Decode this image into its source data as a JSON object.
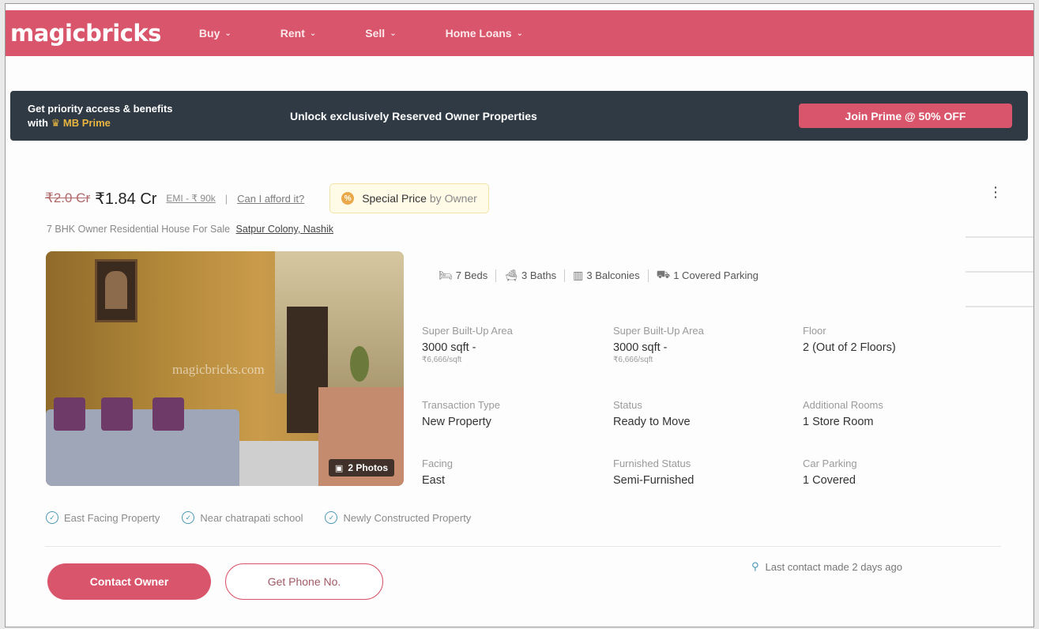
{
  "header": {
    "logo": "magicbricks",
    "nav": [
      {
        "label": "Buy"
      },
      {
        "label": "Rent"
      },
      {
        "label": "Sell"
      },
      {
        "label": "Home Loans"
      }
    ],
    "accent_color": "#d8556b"
  },
  "prime_banner": {
    "left_line1": "Get priority access & benefits",
    "left_line2_prefix": "with",
    "left_line2_brand": "MB Prime",
    "middle": "Unlock exclusively Reserved Owner Properties",
    "button": "Join Prime @ 50% OFF"
  },
  "listing": {
    "old_price": "₹2.0 Cr",
    "price": "₹1.84 Cr",
    "emi": "EMI - ₹ 90k",
    "separator": "|",
    "afford": "Can I afford it?",
    "special_badge_icon": "%",
    "special_price": "Special Price",
    "special_by": "by Owner",
    "title": "7 BHK Owner Residential House For Sale",
    "location": "Satpur Colony, Nashik",
    "photos_count": "2 Photos",
    "photo_watermark": "magicbricks.com",
    "amenities": [
      {
        "icon": "bed-icon",
        "label": "7 Beds"
      },
      {
        "icon": "bath-icon",
        "label": "3 Baths"
      },
      {
        "icon": "balcony-icon",
        "label": "3 Balconies"
      },
      {
        "icon": "parking-icon",
        "label": "1 Covered Parking"
      }
    ],
    "details": [
      {
        "label": "Super Built-Up Area",
        "value": "3000 sqft -",
        "sub": "₹6,666/sqft"
      },
      {
        "label": "Super Built-Up Area",
        "value": "3000 sqft -",
        "sub": "₹6,666/sqft"
      },
      {
        "label": "Floor",
        "value": "2 (Out of 2 Floors)",
        "sub": ""
      },
      {
        "label": "Transaction Type",
        "value": "New Property",
        "sub": ""
      },
      {
        "label": "Status",
        "value": "Ready to Move",
        "sub": ""
      },
      {
        "label": "Additional Rooms",
        "value": "1 Store Room",
        "sub": ""
      },
      {
        "label": "Facing",
        "value": "East",
        "sub": ""
      },
      {
        "label": "Furnished Status",
        "value": "Semi-Furnished",
        "sub": ""
      },
      {
        "label": "Car Parking",
        "value": "1 Covered",
        "sub": ""
      }
    ],
    "tags": [
      "East Facing Property",
      "Near chatrapati school",
      "Newly Constructed Property"
    ],
    "contact_button": "Contact Owner",
    "phone_button": "Get Phone No.",
    "last_contact": "Last contact made 2 days ago"
  }
}
